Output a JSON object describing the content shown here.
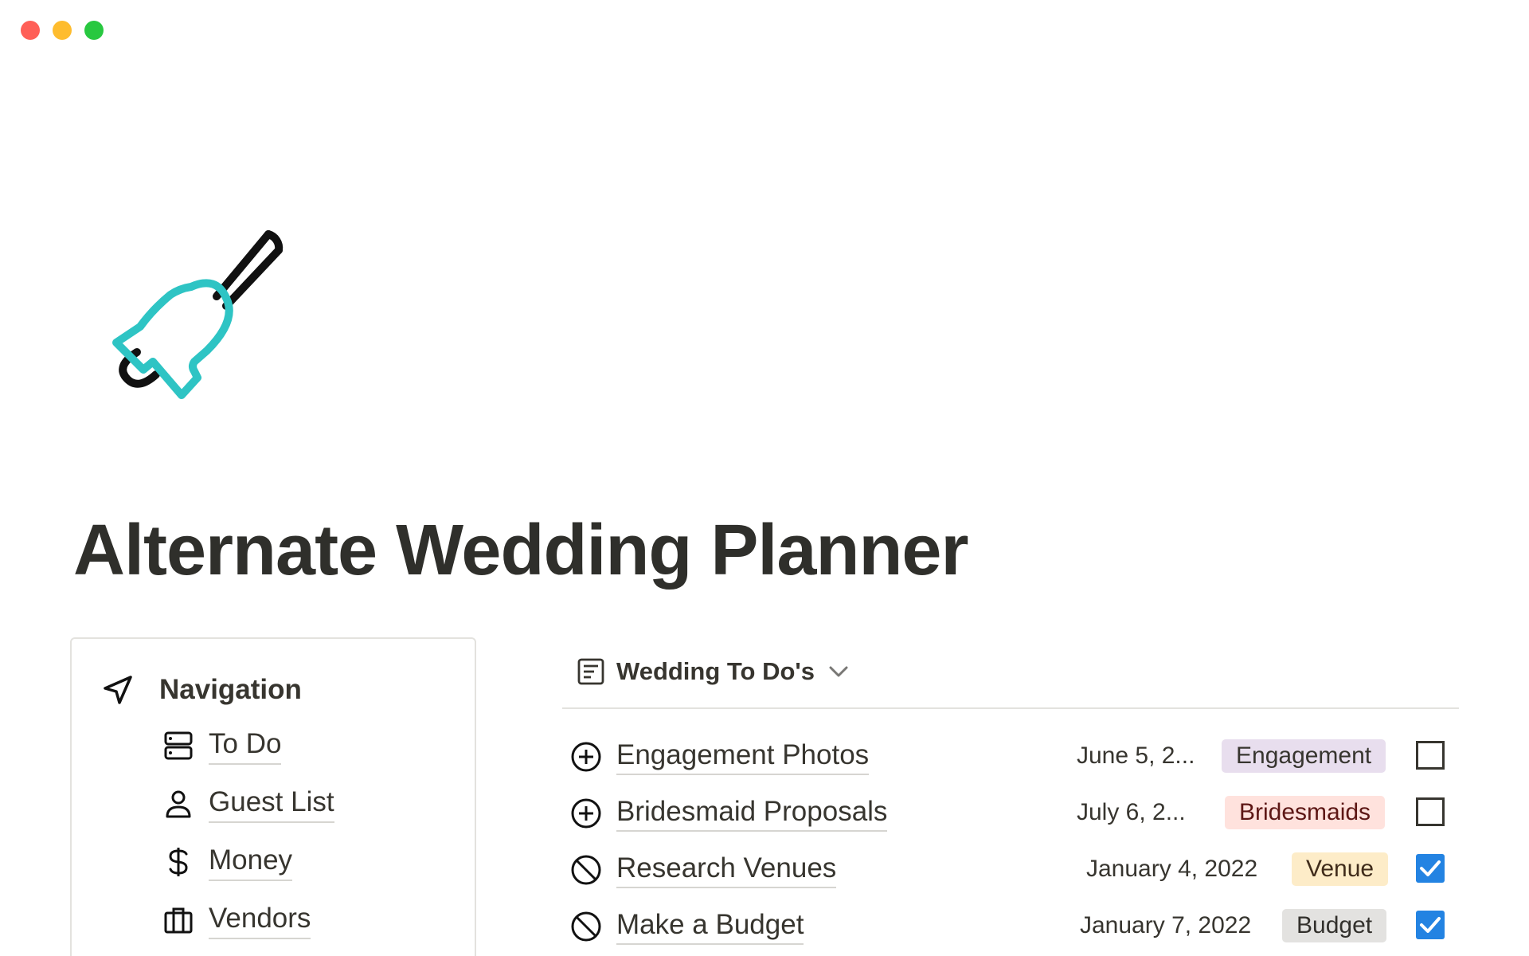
{
  "window": {
    "controls": [
      "close",
      "minimize",
      "zoom"
    ],
    "colors": {
      "close": "#ff5f57",
      "minimize": "#febc2e",
      "zoom": "#28c840"
    }
  },
  "page": {
    "icon": "bell-icon",
    "title": "Alternate Wedding Planner"
  },
  "navigation": {
    "header": "Navigation",
    "header_icon": "navigation-arrow-icon",
    "items": [
      {
        "label": "To Do",
        "icon": "server-icon"
      },
      {
        "label": "Guest List",
        "icon": "person-icon"
      },
      {
        "label": "Money",
        "icon": "dollar-icon"
      },
      {
        "label": "Vendors",
        "icon": "briefcase-icon"
      }
    ]
  },
  "database": {
    "title": "Wedding To Do's",
    "icon": "list-view-icon",
    "rows": [
      {
        "name": "Engagement Photos",
        "status_icon": "plus-circle-icon",
        "date": "June 5, 2...",
        "tag": "Engagement",
        "tag_bg": "#e8deee",
        "tag_fg": "#37352f",
        "done": false
      },
      {
        "name": "Bridesmaid Proposals",
        "status_icon": "plus-circle-icon",
        "date": "July 6, 2...",
        "tag": "Bridesmaids",
        "tag_bg": "#ffe2dd",
        "tag_fg": "#5d1715",
        "done": false
      },
      {
        "name": "Research Venues",
        "status_icon": "prohibited-icon",
        "date": "January 4, 2022",
        "tag": "Venue",
        "tag_bg": "#fdecc8",
        "tag_fg": "#402c1b",
        "done": true
      },
      {
        "name": "Make a Budget",
        "status_icon": "prohibited-icon",
        "date": "January 7, 2022",
        "tag": "Budget",
        "tag_bg": "#e3e2e0",
        "tag_fg": "#32302c",
        "done": true
      }
    ]
  },
  "colors": {
    "accent": "#2383e2",
    "bell": "#2ec4c4",
    "text": "#37352f"
  }
}
